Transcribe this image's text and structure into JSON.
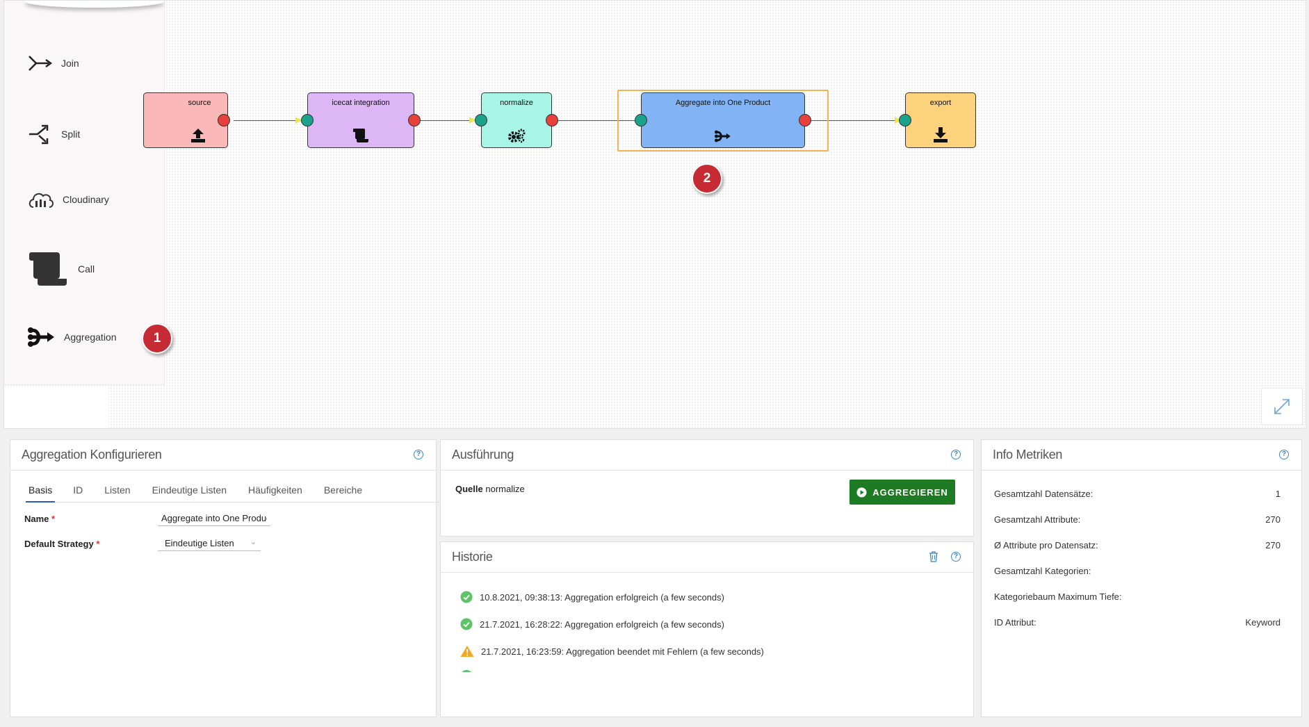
{
  "palette": {
    "items": [
      {
        "label": "Join",
        "icon": "join-icon"
      },
      {
        "label": "Split",
        "icon": "split-icon"
      },
      {
        "label": "Cloudinary",
        "icon": "cloud-icon"
      },
      {
        "label": "Call",
        "icon": "scroll-icon"
      },
      {
        "label": "Aggregation",
        "icon": "aggregation-icon"
      }
    ]
  },
  "badges": {
    "one": "1",
    "two": "2"
  },
  "workflow": {
    "nodes": [
      {
        "label": "source",
        "color": "#fbb8b8",
        "icon": "upload-icon"
      },
      {
        "label": "icecat integration",
        "color": "#dcb6f5",
        "icon": "scroll-icon"
      },
      {
        "label": "normalize",
        "color": "#a8f5e8",
        "icon": "gears-icon"
      },
      {
        "label": "Aggregate into One Product",
        "color": "#82b4f5",
        "icon": "aggregation-icon"
      },
      {
        "label": "export",
        "color": "#fcd27c",
        "icon": "download-icon"
      }
    ]
  },
  "config_panel": {
    "title": "Aggregation Konfigurieren",
    "tabs": [
      "Basis",
      "ID",
      "Listen",
      "Eindeutige Listen",
      "Häufigkeiten",
      "Bereiche"
    ],
    "name_label": "Name",
    "name_value": "Aggregate into One Product",
    "strategy_label": "Default Strategy",
    "strategy_value": "Eindeutige Listen"
  },
  "execution_panel": {
    "title": "Ausführung",
    "source_label": "Quelle",
    "source_value": "normalize",
    "run_button": "AGGREGIEREN"
  },
  "history_panel": {
    "title": "Historie",
    "items": [
      {
        "status": "success",
        "text": "10.8.2021, 09:38:13: Aggregation erfolgreich (a few seconds)"
      },
      {
        "status": "success",
        "text": "21.7.2021, 16:28:22: Aggregation erfolgreich (a few seconds)"
      },
      {
        "status": "warning",
        "text": "21.7.2021, 16:23:59: Aggregation beendet mit Fehlern (a few seconds)"
      }
    ]
  },
  "metrics_panel": {
    "title": "Info Metriken",
    "rows": [
      {
        "label": "Gesamtzahl Datensätze:",
        "value": "1"
      },
      {
        "label": "Gesamtzahl Attribute:",
        "value": "270"
      },
      {
        "label": "Ø Attribute pro Datensatz:",
        "value": "270"
      },
      {
        "label": "Gesamtzahl Kategorien:",
        "value": ""
      },
      {
        "label": "Kategoriebaum Maximum Tiefe:",
        "value": ""
      },
      {
        "label": "ID Attribut:",
        "value": "Keyword"
      }
    ]
  },
  "colors": {
    "accent": "#2a5db0",
    "run": "#1e7b23",
    "badge": "#c62a32",
    "selection": "#f0b35a"
  }
}
